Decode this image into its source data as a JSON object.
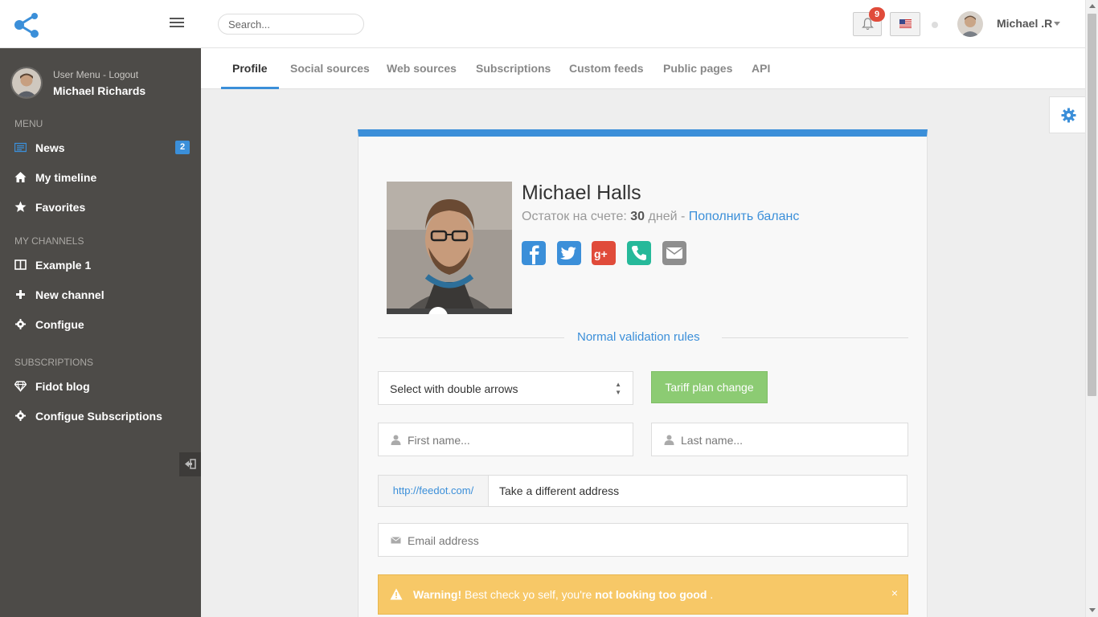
{
  "header": {
    "search_placeholder": "Search...",
    "notifications_count": "9",
    "user_name": "Michael .R"
  },
  "sidebar": {
    "user_menu_label": "User Menu - Logout",
    "user_name": "Michael Richards",
    "menu_heading": "MENU",
    "channels_heading": "MY CHANNELS",
    "subscriptions_heading": "SUBSCRIPTIONS",
    "items": [
      {
        "label": "News",
        "badge": "2"
      },
      {
        "label": "My timeline"
      },
      {
        "label": "Favorites"
      },
      {
        "label": "Example 1"
      },
      {
        "label": "New channel"
      },
      {
        "label": "Configue"
      },
      {
        "label": "Fidot blog"
      },
      {
        "label": "Configue Subscriptions"
      }
    ]
  },
  "tabs": [
    "Profile",
    "Social sources",
    "Web sources",
    "Subscriptions",
    "Custom feeds",
    "Public pages",
    "API"
  ],
  "profile": {
    "name": "Michael Halls",
    "balance_prefix": "Остаток на счете:",
    "balance_days": "30",
    "balance_suffix": "дней -",
    "topup_link": "Пополнить баланс",
    "social_icons": [
      "facebook-icon",
      "twitter-icon",
      "google-plus-icon",
      "phone-icon",
      "email-icon"
    ]
  },
  "form": {
    "section_title": "Normal validation rules",
    "select_value": "Select with double arrows",
    "tariff_button": "Tariff plan change",
    "first_name_placeholder": "First name...",
    "last_name_placeholder": "Last name...",
    "url_prefix": "http://feedot.com/",
    "url_value": "Take a different address",
    "email_placeholder": "Email address"
  },
  "warning": {
    "strong": "Warning!",
    "text": " Best check yo self, you're ",
    "bold_end": "not looking too good",
    "tail": " .",
    "close": "×"
  },
  "colors": {
    "accent": "#3b8fd9",
    "sidebar": "#4d4b48",
    "success": "#8ccb73",
    "warning": "#f7c867"
  }
}
